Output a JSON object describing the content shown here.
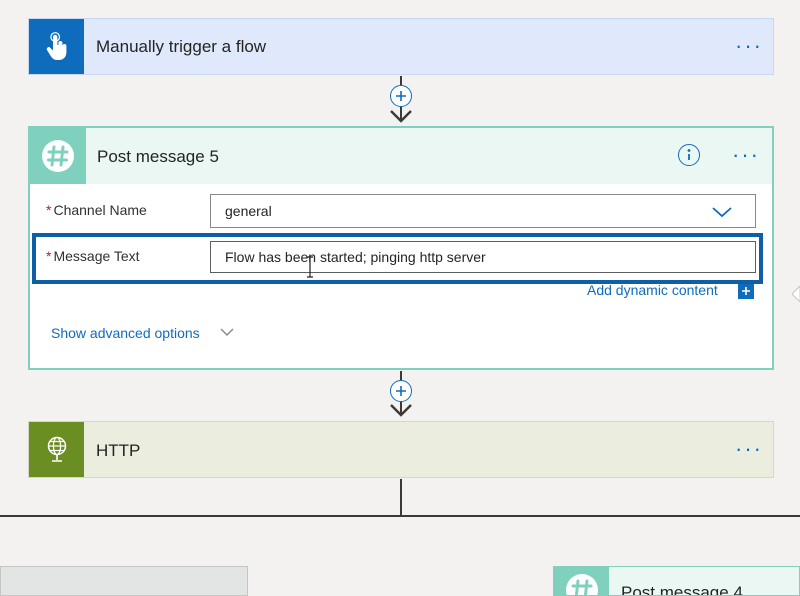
{
  "trigger": {
    "title": "Manually trigger a flow",
    "icon": "hand-touch-icon",
    "accent": "#0f6cbd",
    "background": "#dfe9fb",
    "more_label": "···"
  },
  "post_message": {
    "title": "Post message 5",
    "icon": "slack-hash-icon",
    "accent": "#7fd1be",
    "header_background": "#eaf7f3",
    "info_icon": "info-icon",
    "more_label": "···",
    "channel": {
      "required_mark": "*",
      "label": "Channel Name",
      "value": "general"
    },
    "message": {
      "required_mark": "*",
      "label": "Message Text",
      "value": "Flow has been started; pinging http server"
    },
    "add_dynamic_content": "Add dynamic content",
    "show_advanced": "Show advanced options"
  },
  "http": {
    "title": "HTTP",
    "icon": "globe-icon",
    "accent": "#6b8e23",
    "background": "#ebedde",
    "more_label": "···"
  },
  "bottom_right_card": {
    "title": "Post message 4"
  },
  "colors": {
    "highlight": "#0f5fa8",
    "link": "#0f6cbd"
  }
}
